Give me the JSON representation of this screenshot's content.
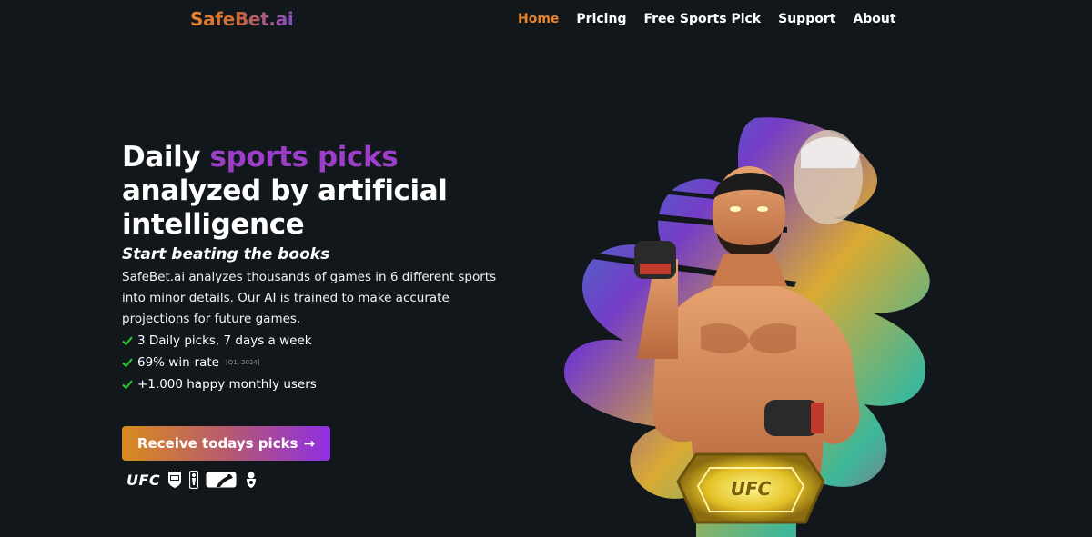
{
  "logo": "SafeBet.ai",
  "nav": {
    "home": "Home",
    "pricing": "Pricing",
    "free_pick": "Free Sports Pick",
    "support": "Support",
    "about": "About"
  },
  "hero": {
    "headline_part1": "Daily ",
    "headline_accent": "sports picks",
    "headline_part2": "analyzed by artificial intelligence",
    "subhead": "Start beating the books",
    "description": "SafeBet.ai analyzes thousands of games in 6 different sports into minor details. Our AI is trained to make accurate projections for future games.",
    "checks": [
      {
        "text": "3 Daily picks, 7 days a week",
        "note": ""
      },
      {
        "text": "69% win-rate",
        "note": "[Q1, 2024]"
      },
      {
        "text": "+1.000 happy monthly users",
        "note": ""
      }
    ],
    "cta_label": "Receive todays picks",
    "cta_arrow": "→"
  },
  "leagues": {
    "ufc": "UFC"
  },
  "colors": {
    "background": "#12171c",
    "accent_orange": "#e8842a",
    "accent_purple": "#9d3ec9",
    "check_green": "#2ec62e"
  },
  "icons": [
    "check-icon",
    "arrow-right-icon",
    "ufc-logo",
    "nfl-logo",
    "nba-logo",
    "mlb-logo",
    "premier-league-logo"
  ]
}
